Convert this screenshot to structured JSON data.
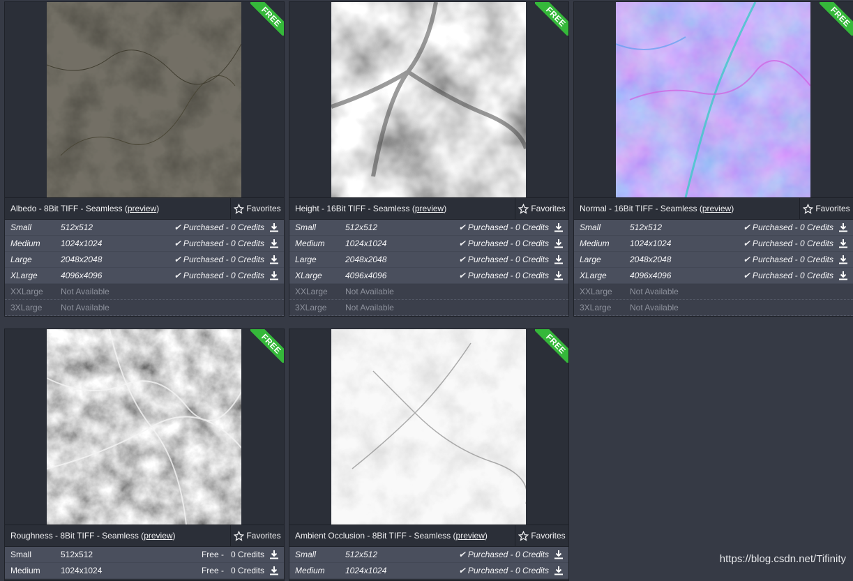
{
  "badge": "FREE",
  "favorites_label": "Favorites",
  "preview_label": "preview",
  "cards": [
    {
      "title": "Albedo - 8Bit TIFF - Seamless",
      "rows": [
        {
          "size": "Small",
          "res": "512x512",
          "status": "✔ Purchased - 0 Credits"
        },
        {
          "size": "Medium",
          "res": "1024x1024",
          "status": "✔ Purchased - 0 Credits"
        },
        {
          "size": "Large",
          "res": "2048x2048",
          "status": "✔ Purchased - 0 Credits"
        },
        {
          "size": "XLarge",
          "res": "4096x4096",
          "status": "✔ Purchased - 0 Credits"
        }
      ],
      "na_rows": [
        {
          "size": "XXLarge",
          "res": "Not Available"
        },
        {
          "size": "3XLarge",
          "res": "Not Available"
        }
      ]
    },
    {
      "title": "Height - 16Bit TIFF - Seamless",
      "rows": [
        {
          "size": "Small",
          "res": "512x512",
          "status": "✔ Purchased - 0 Credits"
        },
        {
          "size": "Medium",
          "res": "1024x1024",
          "status": "✔ Purchased - 0 Credits"
        },
        {
          "size": "Large",
          "res": "2048x2048",
          "status": "✔ Purchased - 0 Credits"
        },
        {
          "size": "XLarge",
          "res": "4096x4096",
          "status": "✔ Purchased - 0 Credits"
        }
      ],
      "na_rows": [
        {
          "size": "XXLarge",
          "res": "Not Available"
        },
        {
          "size": "3XLarge",
          "res": "Not Available"
        }
      ]
    },
    {
      "title": "Normal - 16Bit TIFF - Seamless",
      "rows": [
        {
          "size": "Small",
          "res": "512x512",
          "status": "✔ Purchased - 0 Credits"
        },
        {
          "size": "Medium",
          "res": "1024x1024",
          "status": "✔ Purchased - 0 Credits"
        },
        {
          "size": "Large",
          "res": "2048x2048",
          "status": "✔ Purchased - 0 Credits"
        },
        {
          "size": "XLarge",
          "res": "4096x4096",
          "status": "✔ Purchased - 0 Credits"
        }
      ],
      "na_rows": [
        {
          "size": "XXLarge",
          "res": "Not Available"
        },
        {
          "size": "3XLarge",
          "res": "Not Available"
        }
      ]
    },
    {
      "title": "Roughness - 8Bit TIFF - Seamless",
      "rows": [
        {
          "size": "Small",
          "res": "512x512",
          "status": "Free -   0 Credits"
        },
        {
          "size": "Medium",
          "res": "1024x1024",
          "status": "Free -   0 Credits"
        }
      ],
      "na_rows": []
    },
    {
      "title": "Ambient Occlusion - 8Bit TIFF - Seamless",
      "rows": [
        {
          "size": "Small",
          "res": "512x512",
          "status": "✔ Purchased - 0 Credits"
        },
        {
          "size": "Medium",
          "res": "1024x1024",
          "status": "✔ Purchased - 0 Credits"
        }
      ],
      "na_rows": []
    }
  ],
  "watermark": "https://blog.csdn.net/Tifinity",
  "colors": {
    "ribbon": "#35b83a",
    "card": "#2b2f38",
    "row": "#4a4f5d",
    "page": "#363a45"
  }
}
